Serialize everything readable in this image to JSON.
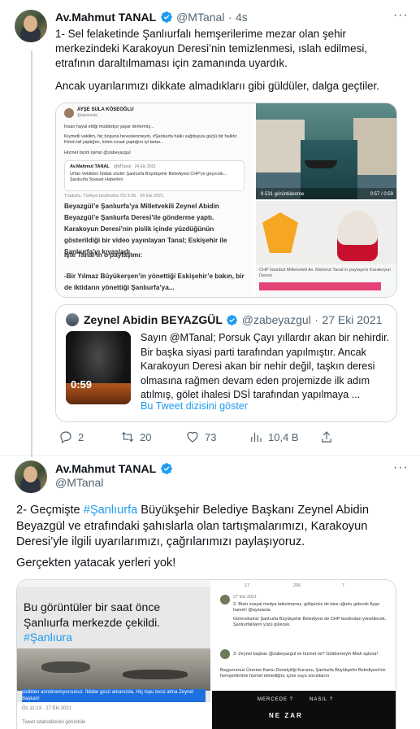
{
  "tweet1": {
    "author_name": "Av.Mahmut TANAL",
    "author_handle": "@MTanal",
    "separator": "·",
    "time": "4s",
    "text_p1": "1- Sel felaketinde Şanlıurfalı hemşerilerime mezar olan şehir merkezindeki Karakoyun Deresi’nin temizlenmesi, ıslah edilmesi, etrafının daraltılmaması için zamanında uyardık.",
    "text_p2": "Ancak uyarılarımızı dikkate almadıklarıı gibi güldüler, dalga geçtiler.",
    "media": {
      "left_card": {
        "name": "AYŞE SULA KÖSEOĞLU",
        "handle": "@aysesula",
        "line1": "İnsan hayal ettiği müddetçe yaşar derlermiş...",
        "line2": "Kıymetli vekilim, hiç boşuna heveslenmeyin, #Şanlıurfa halkı sağduyulu güçlü bir halktır. Kimin laf yaptığını, kimin icraat yaptığını iyi tartar...",
        "line3": "Hizmet bizim işimiz @zabeyazgul",
        "inner_name": "Av.Mahmut TANAL",
        "inner_meta": "@MTanal · 24 Eki 2021",
        "inner_text": "Urfalı Vekilden İddialı sözler Şanlıurfa Büyükşehir Belediyesi CHP'ye geçecek... Şanlıurfa Siyaset Haberleri",
        "meta": "Traduire, Türkiye tarafından Ös 9:36 · 26 Eki 2021",
        "body": "Beyazgül’e Şanlıurfa’ya Milletvekili Zeynel Abidin Beyazgül’e Şanlıurfa Deresi’ile gönderme yaptı. Karakoyun Deresi’nin pislik içinde yüzdüğünün gösterildiği bir video yayınlayan Tanal; Eskişehir ile Şanlıurfa’yı kıyasladı.",
        "body2": "İşte Tanal’ın o paylaşımı:",
        "body3": "-Bir Yılmaz Büyükerşen’in yönettiği Eskişehir’e bakın, bir de iktidarın yönettiği Şanlıurfa’ya..."
      },
      "right_top": {
        "views": "9.531 görüntülenme",
        "time": "0:57 / 0:59"
      },
      "right_bottom": {
        "caption": "CHP İstanbul Milletvekili Av. Mahmut Tanal’ın paylaşımı Karakoyun Deresi"
      }
    },
    "quote": {
      "name": "Zeynel Abidin BEYAZGÜL",
      "handle": "@zabeyazgul",
      "separator": "·",
      "date": "27 Eki 2021",
      "text": "Sayın @MTanal; Porsuk Çayı yıllardır akan bir nehirdir. Bir başka siyasi parti tarafından yapılmıştır. Ancak Karakoyun Deresi akan bir nehir değil, taşkın deresi olmasına rağmen devam eden projemizde ilk adım atılmış, gölet ihalesi DSİ tarafından yapılmaya ...",
      "show_thread": "Bu Tweet dizisini göster",
      "video_duration": "0:59"
    },
    "actions": {
      "replies": "2",
      "retweets": "20",
      "likes": "73",
      "views": "10,4 B"
    }
  },
  "tweet2": {
    "author_name": "Av.Mahmut TANAL",
    "author_handle": "@MTanal",
    "text_prefix": "2- Geçmişte ",
    "hashtag": "#Şanlıurfa",
    "text_rest": " Büyükşehir Belediye Başkanı Zeynel Abidin Beyazgül ve etrafındaki şahıslarla olan tartışmalarımızı, Karakoyun Deresi’yle ilgili uyarılarımızı, çağrılarımızı paylaşıyoruz.",
    "text_p2": "Gerçekten yatacak yerleri yok!",
    "media_left": {
      "headline1": "Bu görüntüler bir saat önce",
      "headline2": "Şanlıurfa merkezde çekildi.",
      "hashtag": "#Şanlıura",
      "highlight": "pisliklen arındıramıyorsunuz. İktidar gücü arkanızda. Hiç topu bıcsi atma Zeynel Başkan!",
      "date": "Ös 11:13 · 27 Eki 2021",
      "stats": "Tweet istatistiklerini görüntüle"
    },
    "media_right": {
      "date": "27 Eki 2021",
      "reply1": "2- Bizin sosyal medya takicimamız, gölişünüz de bize uğurlu gelecek Ayşe hanım! @aysesula",
      "reply2": "Göreceksiniz Şanlıurfa Büyükşehir Belediyesi de CHP tarafından yönetilecek. Şanlıurfalıların yüzü gülecek.",
      "reply3": "3- Zeynel başkan @zabeyazgul ve hizmet mi? Güldürmeyin Allah aşkına!",
      "reply4": "Başyurumuz Üzerine Kamu Denetçiliği Kurumu, Şanlıurfa Büyükşehir Belediyesi’nin hemşerilerime hizmet etmediğini, içme suyu sorunlarını",
      "counts": [
        "17",
        "206",
        "7"
      ],
      "video_text": "NE ZAR",
      "video_text2": "MERCEDE ?",
      "video_text3": "NASIL ?"
    }
  }
}
